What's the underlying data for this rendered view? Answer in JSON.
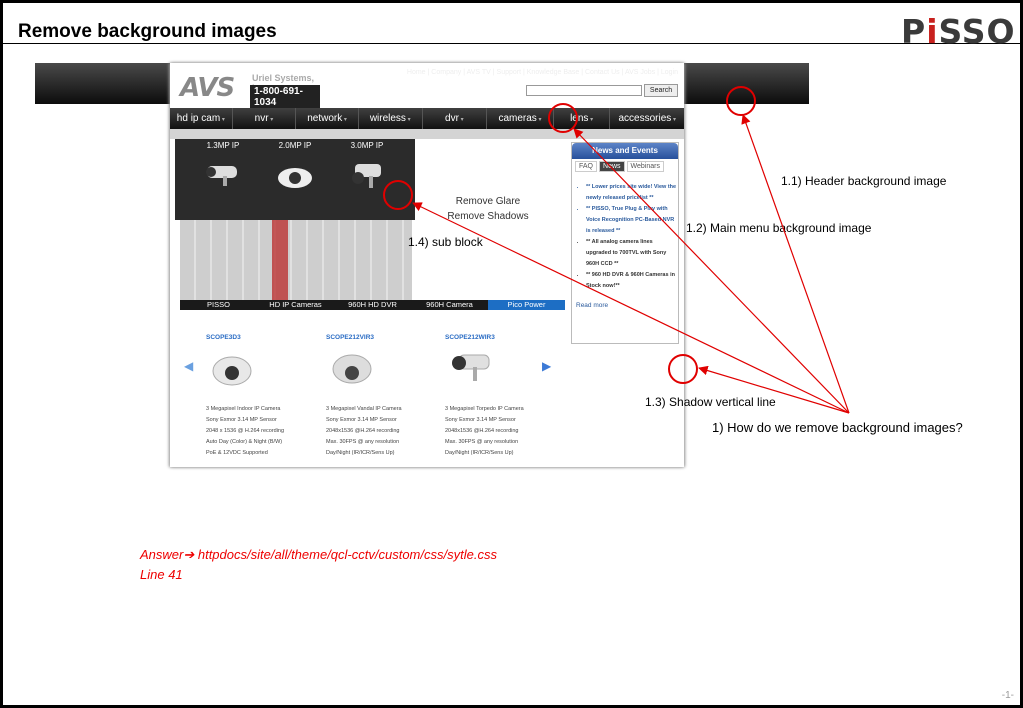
{
  "slide": {
    "title": "Remove background images",
    "brand": "PiSSO",
    "page_number": "-1-"
  },
  "site": {
    "logo_letters": "AVS",
    "company": "Uriel Systems, Inc.",
    "phone": "1-800-691-1034",
    "top_links": "Home | Company | AVS TV | Support | Knowledge Base | Contact Us | AVS Jobs | Login",
    "search_button": "Search",
    "menu": [
      "hd ip cam",
      "nvr",
      "network",
      "wireless",
      "dvr",
      "cameras",
      "lens",
      "accessories"
    ],
    "dropdown": [
      {
        "label": "1.3MP IP"
      },
      {
        "label": "2.0MP IP"
      },
      {
        "label": "3.0MP IP"
      }
    ],
    "hero_text": [
      "Remove Glare",
      "Remove Shadows"
    ],
    "tabs": [
      "PISSO",
      "HD IP Cameras",
      "960H HD DVR",
      "960H Camera",
      "Pico Power"
    ],
    "news": {
      "title": "News and Events",
      "tabs": [
        "FAQ",
        "News",
        "Webinars"
      ],
      "items": [
        "** Lower prices site wide! View the newly released pricelist **",
        "** PISSO, True Plug & Play with Voice Recognition PC-Based NVR is released **",
        "** All analog camera lines upgraded to 700TVL with Sony 960H CCD **",
        "** 960 HD DVR & 960H Cameras in Stock now!**"
      ],
      "read_more": "Read more"
    },
    "products": [
      {
        "name": "SCOPE3D3",
        "spec": [
          "3 Megapixel Indoor IP Camera",
          "Sony Exmor 3.14 MP Sensor",
          "2048 x 1536 @ H.264 recording",
          "Auto Day (Color) & Night (B/W)",
          "PoE & 12VDC Supported"
        ]
      },
      {
        "name": "SCOPE212VIR3",
        "spec": [
          "3 Megapixel Vandal IP Camera",
          "Sony Exmor 3.14 MP Sensor",
          "2048x1536 @H.264 recording",
          "Max. 30FPS @ any resolution",
          "Day/Night (IR/ICR/Sens Up)"
        ]
      },
      {
        "name": "SCOPE212WIR3",
        "spec": [
          "3 Megapixel Torpedo IP Camera",
          "Sony Exmor 3.14 MP Sensor",
          "2048x1536 @H.264 recording",
          "Max. 30FPS @ any resolution",
          "Day/Night (IR/ICR/Sens Up)"
        ]
      }
    ]
  },
  "annotations": {
    "a1_1": "1.1) Header background image",
    "a1_2": "1.2) Main menu background image",
    "a1_3": "1.3) Shadow vertical line",
    "a1_4": "1.4) sub block",
    "a1": "1) How do we remove background images?"
  },
  "answer": {
    "line1": "Answer➔ httpdocs/site/all/theme/qcl-cctv/custom/css/sytle.css",
    "line2": "Line 41"
  },
  "colors": {
    "annotation": "#e00000",
    "link": "#2a5a9c",
    "active_tab": "#1d6ec4"
  }
}
